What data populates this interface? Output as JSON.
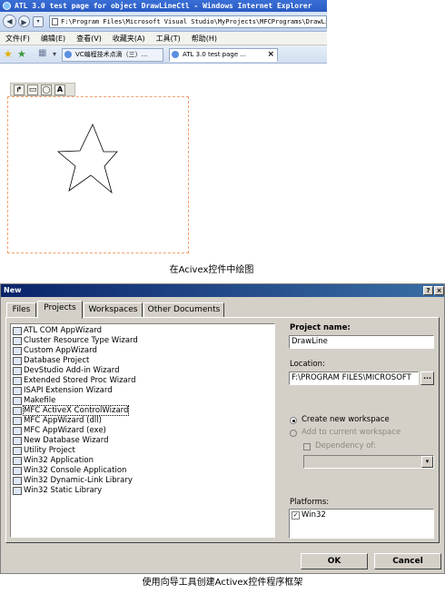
{
  "ie": {
    "title": "ATL 3.0 test page for object DrawLineCtl - Windows Internet Explorer",
    "address": "F:\\Program Files\\Microsoft Visual Studio\\MyProjects\\MFCPrograms\\DrawLine\\",
    "menu": [
      "文件(F)",
      "编辑(E)",
      "查看(V)",
      "收藏夹(A)",
      "工具(T)",
      "帮助(H)"
    ],
    "tabs": [
      "VC编程技术点滴（三）...",
      "ATL 3.0 test page ..."
    ],
    "tab_close": "×",
    "toolbar": [
      "↱",
      "▭",
      "◯",
      "A"
    ]
  },
  "caption1": "在Acivex控件中绘图",
  "dialog": {
    "title": "New",
    "help_btn": "?",
    "close_btn": "×",
    "tabs": [
      "Files",
      "Projects",
      "Workspaces",
      "Other Documents"
    ],
    "projects": [
      "ATL COM AppWizard",
      "Cluster Resource Type Wizard",
      "Custom AppWizard",
      "Database Project",
      "DevStudio Add-in Wizard",
      "Extended Stored Proc Wizard",
      "ISAPI Extension Wizard",
      "Makefile",
      "MFC ActiveX ControlWizard",
      "MFC AppWizard (dll)",
      "MFC AppWizard (exe)",
      "New Database Wizard",
      "Utility Project",
      "Win32 Application",
      "Win32 Console Application",
      "Win32 Dynamic-Link Library",
      "Win32 Static Library"
    ],
    "selected_project": "MFC ActiveX ControlWizard",
    "project_name_label": "Project name:",
    "project_name_value": "DrawLine",
    "location_label": "Location:",
    "location_value": "F:\\PROGRAM FILES\\MICROSOFT",
    "browse_btn": "...",
    "create_new": "Create new workspace",
    "add_current": "Add to current workspace",
    "dependency": "Dependency of:",
    "platforms_label": "Platforms:",
    "platform": "Win32",
    "ok": "OK",
    "cancel": "Cancel"
  },
  "caption2": "使用向导工具创建Activex控件程序框架",
  "colors": {
    "ie_title": "#2a5bc4",
    "dialog_title": "#0a246a",
    "dialog_bg": "#d4d0c8",
    "canvas_border": "#f0a070"
  }
}
